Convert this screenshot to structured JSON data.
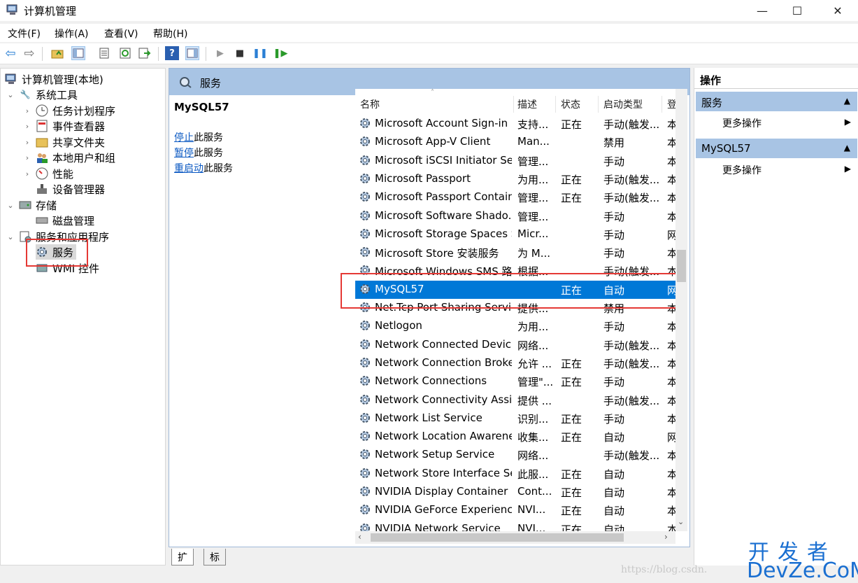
{
  "window": {
    "title": "计算机管理",
    "minimize": "—",
    "maximize": "☐",
    "close": "✕"
  },
  "menu": [
    "文件(F)",
    "操作(A)",
    "查看(V)",
    "帮助(H)"
  ],
  "tree": {
    "root": "计算机管理(本地)",
    "system_tools": "系统工具",
    "task_scheduler": "任务计划程序",
    "event_viewer": "事件查看器",
    "shared_folders": "共享文件夹",
    "local_users": "本地用户和组",
    "performance": "性能",
    "device_manager": "设备管理器",
    "storage": "存储",
    "disk_management": "磁盘管理",
    "services_apps": "服务和应用程序",
    "services": "服务",
    "wmi": "WMI 控件"
  },
  "center": {
    "header": "服务",
    "selected_service": "MySQL57",
    "actions": [
      {
        "link": "停止",
        "rest": "此服务"
      },
      {
        "link": "暂停",
        "rest": "此服务"
      },
      {
        "link": "重启动",
        "rest": "此服务"
      }
    ],
    "columns": {
      "name": "名称",
      "desc": "描述",
      "status": "状态",
      "startup": "启动类型",
      "logon": "登"
    },
    "rows": [
      {
        "name": "Microsoft Account Sign-in ...",
        "desc": "支持...",
        "status": "正在",
        "startup": "手动(触发...",
        "logon": "本"
      },
      {
        "name": "Microsoft App-V Client",
        "desc": "Man...",
        "status": "",
        "startup": "禁用",
        "logon": "本"
      },
      {
        "name": "Microsoft iSCSI Initiator Ser...",
        "desc": "管理...",
        "status": "",
        "startup": "手动",
        "logon": "本"
      },
      {
        "name": "Microsoft Passport",
        "desc": "为用...",
        "status": "正在",
        "startup": "手动(触发...",
        "logon": "本"
      },
      {
        "name": "Microsoft Passport Container",
        "desc": "管理...",
        "status": "正在",
        "startup": "手动(触发...",
        "logon": "本"
      },
      {
        "name": "Microsoft Software Shado...",
        "desc": "管理...",
        "status": "",
        "startup": "手动",
        "logon": "本"
      },
      {
        "name": "Microsoft Storage Spaces S",
        "desc": "Micr...",
        "status": "",
        "startup": "手动",
        "logon": "网"
      },
      {
        "name": "Microsoft Store 安装服务",
        "desc": "为 M...",
        "status": "",
        "startup": "手动",
        "logon": "本"
      },
      {
        "name": "Microsoft Windows SMS 路...",
        "desc": "根据...",
        "status": "",
        "startup": "手动(触发...",
        "logon": "本"
      },
      {
        "name": "MySQL57",
        "desc": "",
        "status": "正在",
        "startup": "自动",
        "logon": "网"
      },
      {
        "name": "Net.Tcp Port Sharing Service",
        "desc": "提供...",
        "status": "",
        "startup": "禁用",
        "logon": "本"
      },
      {
        "name": "Netlogon",
        "desc": "为用...",
        "status": "",
        "startup": "手动",
        "logon": "本"
      },
      {
        "name": "Network Connected Devic...",
        "desc": "网络...",
        "status": "",
        "startup": "手动(触发...",
        "logon": "本"
      },
      {
        "name": "Network Connection Broker",
        "desc": "允许 ...",
        "status": "正在",
        "startup": "手动(触发...",
        "logon": "本"
      },
      {
        "name": "Network Connections",
        "desc": "管理\"...",
        "status": "正在",
        "startup": "手动",
        "logon": "本"
      },
      {
        "name": "Network Connectivity Assis...",
        "desc": "提供 ...",
        "status": "",
        "startup": "手动(触发...",
        "logon": "本"
      },
      {
        "name": "Network List Service",
        "desc": "识别...",
        "status": "正在",
        "startup": "手动",
        "logon": "本"
      },
      {
        "name": "Network Location Awarene",
        "desc": "收集...",
        "status": "正在",
        "startup": "自动",
        "logon": "网"
      },
      {
        "name": "Network Setup Service",
        "desc": "网络...",
        "status": "",
        "startup": "手动(触发...",
        "logon": "本"
      },
      {
        "name": "Network Store Interface Se...",
        "desc": "此服...",
        "status": "正在",
        "startup": "自动",
        "logon": "本"
      },
      {
        "name": "NVIDIA Display Container LS",
        "desc": "Cont...",
        "status": "正在",
        "startup": "自动",
        "logon": "本"
      },
      {
        "name": "NVIDIA GeForce Experienc...",
        "desc": "NVI...",
        "status": "正在",
        "startup": "自动",
        "logon": "本"
      },
      {
        "name": "NVIDIA Network Service",
        "desc": "NVI...",
        "status": "正在",
        "startup": "自动",
        "logon": "本"
      }
    ],
    "selected_index": 9,
    "tabs": [
      "扩展",
      "标准"
    ]
  },
  "actions_pane": {
    "title": "操作",
    "group1": "服务",
    "group1_item": "更多操作",
    "group2": "MySQL57",
    "group2_item": "更多操作"
  },
  "watermark": {
    "url": "https://blog.csdn.",
    "cn": "开发者",
    "en": "DevZe.CoM"
  },
  "colors": {
    "selection": "#0078d7",
    "header_blue": "#a8c4e4",
    "highlight_box": "#e53935",
    "link": "#0a58c2"
  }
}
